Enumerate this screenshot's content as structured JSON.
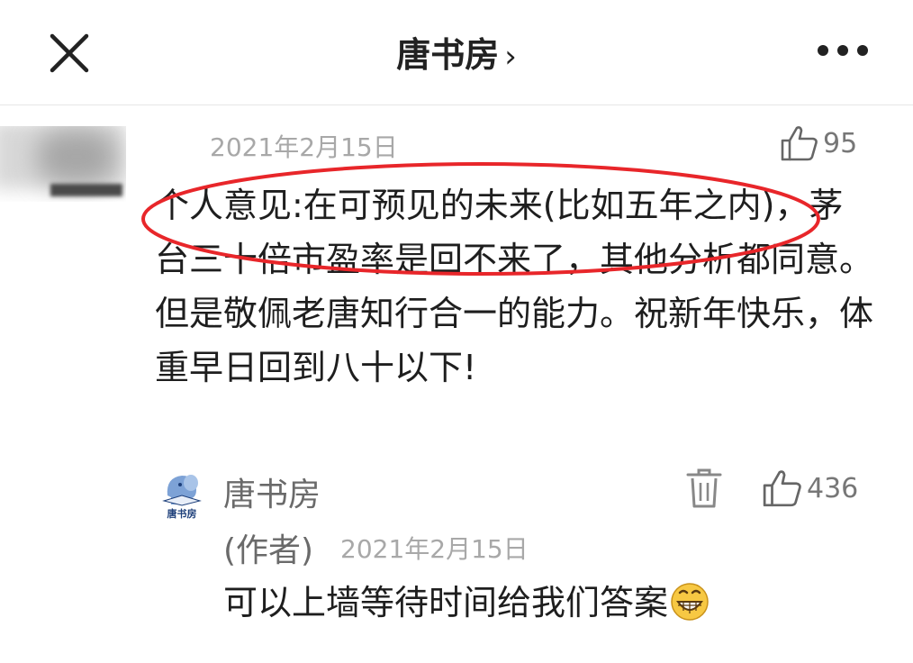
{
  "header": {
    "title": "唐书房",
    "chevron": "›"
  },
  "comment": {
    "date": "2021年2月15日",
    "like_count": "95",
    "text": "个人意见:在可预见的未来(比如五年之内)，茅台三十倍市盈率是回不来了，其他分析都同意。但是敬佩老唐知行合一的能力。祝新年快乐，体重早日回到八十以下!"
  },
  "reply": {
    "avatar_label": "唐书房",
    "author": "唐书房",
    "author_tag": "(作者)",
    "date": "2021年2月15日",
    "like_count": "436",
    "text": "可以上墙等待时间给我们答案"
  },
  "colors": {
    "highlight": "#e8262a",
    "text": "#1e1e1e",
    "muted": "#a8a8a8"
  },
  "icons": [
    "close-icon",
    "chevron-right-icon",
    "more-icon",
    "thumbs-up-icon",
    "trash-icon",
    "grinning-face-emoji"
  ]
}
